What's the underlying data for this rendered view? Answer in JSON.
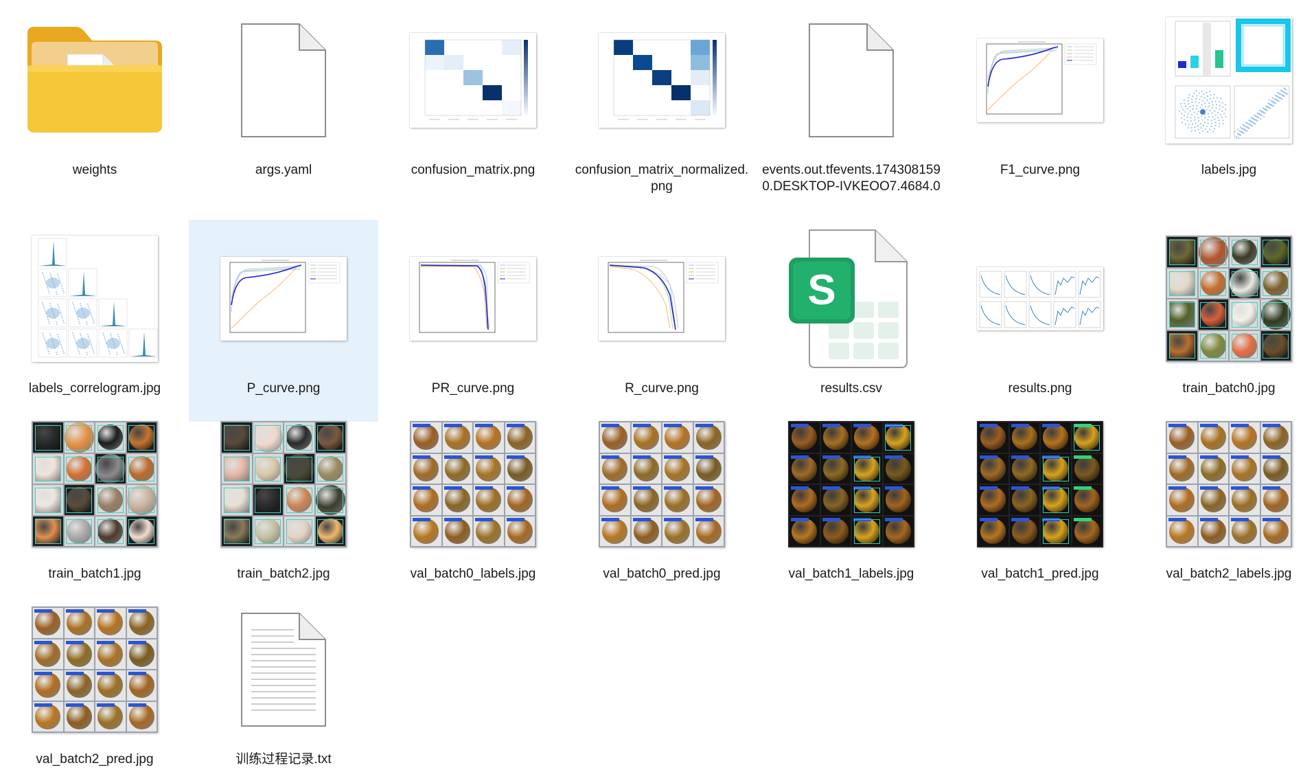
{
  "files": [
    {
      "name": "weights",
      "kind": "folder"
    },
    {
      "name": "args.yaml",
      "kind": "blank"
    },
    {
      "name": "confusion_matrix.png",
      "kind": "confusion"
    },
    {
      "name": "confusion_matrix_normalized.png",
      "kind": "confusion_norm"
    },
    {
      "name": "events.out.tfevents.1743081590.DESKTOP-IVKEOO7.4684.0",
      "kind": "blank"
    },
    {
      "name": "F1_curve.png",
      "kind": "curve"
    },
    {
      "name": "labels.jpg",
      "kind": "labels"
    },
    {
      "name": "labels_correlogram.jpg",
      "kind": "correlogram"
    },
    {
      "name": "P_curve.png",
      "kind": "curve"
    },
    {
      "name": "PR_curve.png",
      "kind": "curve_pr"
    },
    {
      "name": "R_curve.png",
      "kind": "curve_r"
    },
    {
      "name": "results.csv",
      "kind": "spreadsheet"
    },
    {
      "name": "results.png",
      "kind": "results"
    },
    {
      "name": "train_batch0.jpg",
      "kind": "mosaic"
    },
    {
      "name": "train_batch1.jpg",
      "kind": "mosaic"
    },
    {
      "name": "train_batch2.jpg",
      "kind": "mosaic"
    },
    {
      "name": "val_batch0_labels.jpg",
      "kind": "mosaic"
    },
    {
      "name": "val_batch0_pred.jpg",
      "kind": "mosaic"
    },
    {
      "name": "val_batch1_labels.jpg",
      "kind": "mosaic"
    },
    {
      "name": "val_batch1_pred.jpg",
      "kind": "mosaic"
    },
    {
      "name": "val_batch2_labels.jpg",
      "kind": "mosaic"
    },
    {
      "name": "val_batch2_pred.jpg",
      "kind": "mosaic"
    },
    {
      "name": "训练过程记录.txt",
      "kind": "text"
    }
  ],
  "selected_file": "P_curve.png",
  "colors": {
    "selection": "#e5f1fb",
    "folder": "#f5c233",
    "spreadsheet": "#1f9d62",
    "curve_blue": "#1f1fd1"
  }
}
